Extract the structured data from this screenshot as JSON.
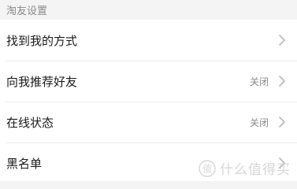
{
  "section": {
    "title": "淘友设置"
  },
  "rows": [
    {
      "label": "找到我的方式",
      "value": "",
      "chevron": "chevron-right-icon"
    },
    {
      "label": "向我推荐好友",
      "value": "关闭",
      "chevron": "chevron-right-icon"
    },
    {
      "label": "在线状态",
      "value": "关闭",
      "chevron": "chevron-right-icon"
    },
    {
      "label": "黑名单",
      "value": "",
      "chevron": "chevron-right-icon"
    }
  ],
  "watermark": {
    "badge": "值",
    "text": "什么值得买"
  },
  "colors": {
    "background": "#f4f4f4",
    "row_background": "#ffffff",
    "label": "#1a1a1a",
    "secondary": "#8a8a8a",
    "divider": "#ececec",
    "chevron": "#b8b8b8"
  }
}
